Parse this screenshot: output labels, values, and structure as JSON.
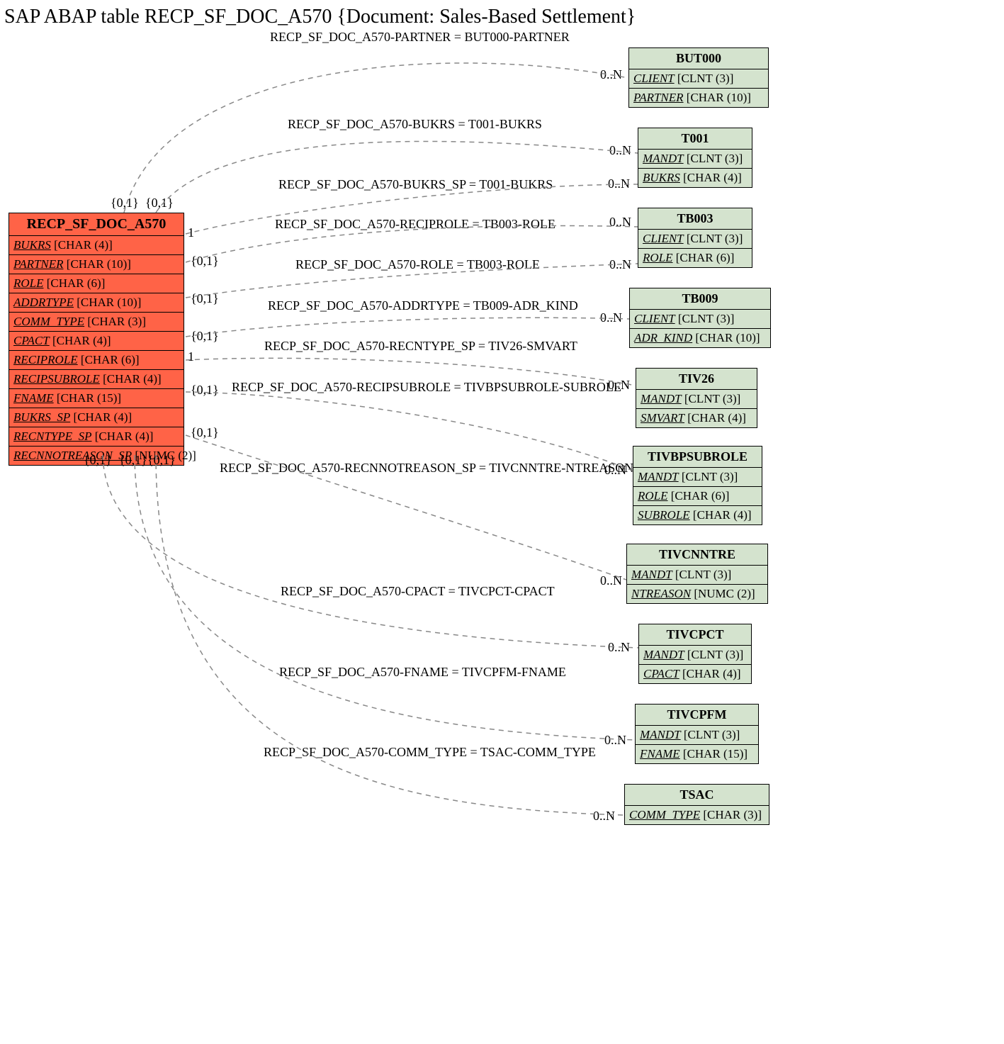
{
  "title": "SAP ABAP table RECP_SF_DOC_A570 {Document: Sales-Based Settlement}",
  "main": {
    "name": "RECP_SF_DOC_A570",
    "fields": [
      {
        "name": "BUKRS",
        "type": "[CHAR (4)]"
      },
      {
        "name": "PARTNER",
        "type": "[CHAR (10)]"
      },
      {
        "name": "ROLE",
        "type": "[CHAR (6)]"
      },
      {
        "name": "ADDRTYPE",
        "type": "[CHAR (10)]"
      },
      {
        "name": "COMM_TYPE",
        "type": "[CHAR (3)]"
      },
      {
        "name": "CPACT",
        "type": "[CHAR (4)]"
      },
      {
        "name": "RECIPROLE",
        "type": "[CHAR (6)]"
      },
      {
        "name": "RECIPSUBROLE",
        "type": "[CHAR (4)]"
      },
      {
        "name": "FNAME",
        "type": "[CHAR (15)]"
      },
      {
        "name": "BUKRS_SP",
        "type": "[CHAR (4)]"
      },
      {
        "name": "RECNTYPE_SP",
        "type": "[CHAR (4)]"
      },
      {
        "name": "RECNNOTREASON_SP",
        "type": "[NUMC (2)]"
      }
    ]
  },
  "rel": [
    {
      "name": "BUT000",
      "fields": [
        {
          "name": "CLIENT",
          "type": "[CLNT (3)]"
        },
        {
          "name": "PARTNER",
          "type": "[CHAR (10)]"
        }
      ],
      "edge": "RECP_SF_DOC_A570-PARTNER = BUT000-PARTNER",
      "leftCard": "{0,1}",
      "rightCard": "0..N"
    },
    {
      "name": "T001",
      "fields": [
        {
          "name": "MANDT",
          "type": "[CLNT (3)]"
        },
        {
          "name": "BUKRS",
          "type": "[CHAR (4)]"
        }
      ],
      "edge": "RECP_SF_DOC_A570-BUKRS = T001-BUKRS",
      "leftCard": "{0,1}",
      "rightCard": "0..N",
      "extra": {
        "edge": "RECP_SF_DOC_A570-BUKRS_SP = T001-BUKRS",
        "leftCard": "1",
        "rightCard": "0..N"
      }
    },
    {
      "name": "TB003",
      "fields": [
        {
          "name": "CLIENT",
          "type": "[CLNT (3)]"
        },
        {
          "name": "ROLE",
          "type": "[CHAR (6)]"
        }
      ],
      "edge": "RECP_SF_DOC_A570-RECIPROLE = TB003-ROLE",
      "leftCard": "{0,1}",
      "rightCard": "0..N",
      "extra": {
        "edge": "RECP_SF_DOC_A570-ROLE = TB003-ROLE",
        "leftCard": "{0,1}",
        "rightCard": "0..N"
      }
    },
    {
      "name": "TB009",
      "fields": [
        {
          "name": "CLIENT",
          "type": "[CLNT (3)]"
        },
        {
          "name": "ADR_KIND",
          "type": "[CHAR (10)]"
        }
      ],
      "edge": "RECP_SF_DOC_A570-ADDRTYPE = TB009-ADR_KIND",
      "leftCard": "{0,1}",
      "rightCard": "0..N"
    },
    {
      "name": "TIV26",
      "fields": [
        {
          "name": "MANDT",
          "type": "[CLNT (3)]"
        },
        {
          "name": "SMVART",
          "type": "[CHAR (4)]"
        }
      ],
      "edge": "RECP_SF_DOC_A570-RECNTYPE_SP = TIV26-SMVART",
      "leftCard": "1",
      "rightCard": "0..N"
    },
    {
      "name": "TIVBPSUBROLE",
      "fields": [
        {
          "name": "MANDT",
          "type": "[CLNT (3)]"
        },
        {
          "name": "ROLE",
          "type": "[CHAR (6)]"
        },
        {
          "name": "SUBROLE",
          "type": "[CHAR (4)]"
        }
      ],
      "edge": "RECP_SF_DOC_A570-RECIPSUBROLE = TIVBPSUBROLE-SUBROLE",
      "leftCard": "{0,1}",
      "rightCard": "0..N"
    },
    {
      "name": "TIVCNNTRE",
      "fields": [
        {
          "name": "MANDT",
          "type": "[CLNT (3)]"
        },
        {
          "name": "NTREASON",
          "type": "[NUMC (2)]"
        }
      ],
      "edge": "RECP_SF_DOC_A570-RECNNOTREASON_SP = TIVCNNTRE-NTREASON",
      "leftCard": "{0,1}",
      "rightCard": "0..N"
    },
    {
      "name": "TIVCPCT",
      "fields": [
        {
          "name": "MANDT",
          "type": "[CLNT (3)]"
        },
        {
          "name": "CPACT",
          "type": "[CHAR (4)]"
        }
      ],
      "edge": "RECP_SF_DOC_A570-CPACT = TIVCPCT-CPACT",
      "leftCard": "{0,1}",
      "rightCard": "0..N"
    },
    {
      "name": "TIVCPFM",
      "fields": [
        {
          "name": "MANDT",
          "type": "[CLNT (3)]"
        },
        {
          "name": "FNAME",
          "type": "[CHAR (15)]"
        }
      ],
      "edge": "RECP_SF_DOC_A570-FNAME = TIVCPFM-FNAME",
      "leftCard": "{0,1}",
      "rightCard": "0..N"
    },
    {
      "name": "TSAC",
      "fields": [
        {
          "name": "COMM_TYPE",
          "type": "[CHAR (3)]"
        }
      ],
      "edge": "RECP_SF_DOC_A570-COMM_TYPE = TSAC-COMM_TYPE",
      "leftCard": "{0,1}",
      "rightCard": "0..N"
    }
  ],
  "extraLeftCards": {
    "bl1": "{0,1}",
    "bl2": "{0,1}",
    "bl3": "{0,1}"
  }
}
